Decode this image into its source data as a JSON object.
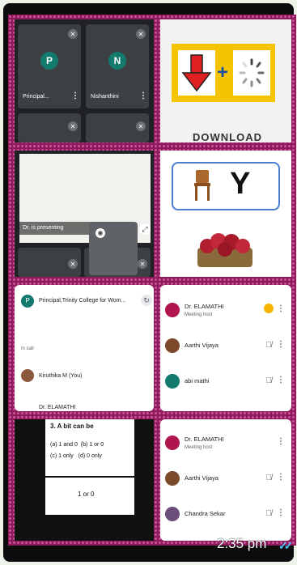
{
  "meet_grid": {
    "participants": [
      {
        "initial": "P",
        "name": "Principal...",
        "color": "#137a6e"
      },
      {
        "initial": "N",
        "name": "Nishanthini",
        "color": "#137a6e"
      }
    ]
  },
  "download_slide": {
    "caption": "DOWNLOAD"
  },
  "chair_slide": {
    "letter": "Y"
  },
  "presenting_tile": {
    "label": "Dr. is presenting"
  },
  "chat_panel": {
    "header": "Principal,Trinity College for Wom...",
    "section": "In call",
    "you": "Kiruthika M (You)",
    "partial": "Dr. ELAMATHI"
  },
  "people_panel_1": {
    "rows": [
      {
        "name": "Dr. ELAMATHI",
        "sub": "Meeting host",
        "color": "#b0154d"
      },
      {
        "name": "Aarthi Vijaya",
        "sub": "",
        "color": "#7a4a2a"
      },
      {
        "name": "abi mathi",
        "sub": "",
        "color": "#137a6e"
      }
    ]
  },
  "quiz_tile": {
    "question": "3. A bit can be",
    "options_line1": "(a) 1 and 0  (b) 1 or 0",
    "options_line2": "(c) 1 only   (d) 0 only",
    "answer": "1 or 0"
  },
  "people_panel_2": {
    "rows": [
      {
        "name": "Dr. ELAMATHI",
        "sub": "Meeting host",
        "color": "#b0154d"
      },
      {
        "name": "Aarthi Vijaya",
        "sub": "",
        "color": "#7a4a2a"
      },
      {
        "name": "Chandra Sekar",
        "sub": "",
        "color": "#6b4f7a"
      }
    ]
  },
  "message": {
    "time": "2:35 pm"
  }
}
